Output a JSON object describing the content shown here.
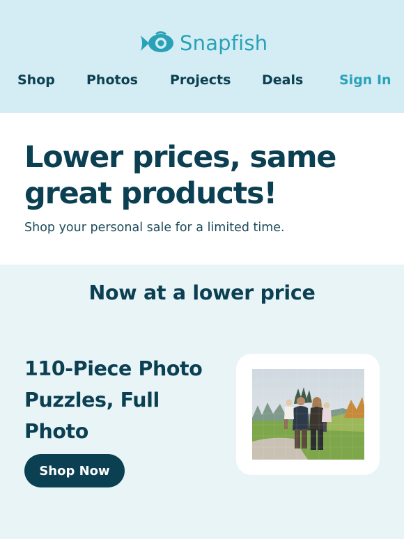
{
  "brand": {
    "name": "Snapfish",
    "logo_icon": "fish-logo-icon",
    "accent": "#29a2b8",
    "dark": "#0b3f52"
  },
  "nav": {
    "items": [
      {
        "label": "Shop"
      },
      {
        "label": "Photos"
      },
      {
        "label": "Projects"
      },
      {
        "label": "Deals"
      },
      {
        "label": "Sign In"
      }
    ]
  },
  "hero": {
    "title_line1": "Lower prices, same",
    "title_line2": "great products!",
    "subtitle": "Shop your personal sale for a limited time."
  },
  "promo": {
    "heading": "Now at a lower price",
    "product_line1": "110-Piece Photo",
    "product_line2": "Puzzles, Full",
    "product_line3": "Photo",
    "cta_label": "Shop Now",
    "image": "family-photo-puzzle"
  }
}
